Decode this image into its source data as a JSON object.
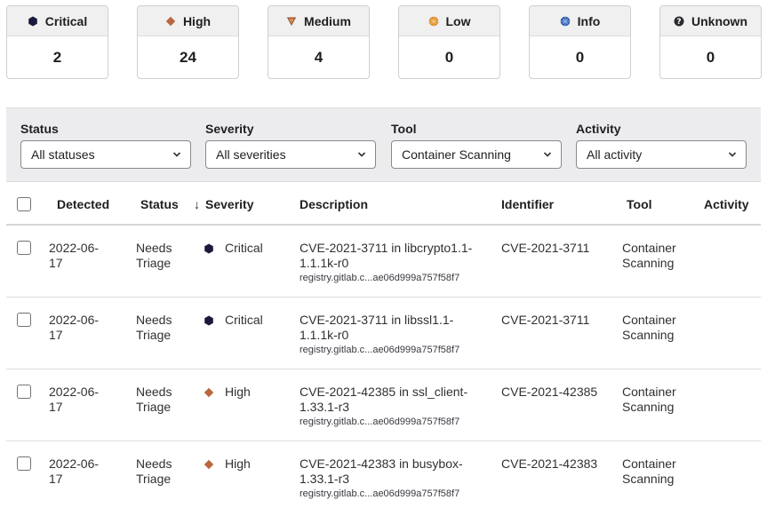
{
  "severity_cards": [
    {
      "label": "Critical",
      "count": "2",
      "icon": "critical-hexagon-icon",
      "color": "#2f2a6b"
    },
    {
      "label": "High",
      "count": "24",
      "icon": "high-diamond-icon",
      "color": "#c0724c"
    },
    {
      "label": "Medium",
      "count": "4",
      "icon": "medium-triangle-icon",
      "color": "#a4653e"
    },
    {
      "label": "Low",
      "count": "0",
      "icon": "low-circle-icon",
      "color": "#d68f2b"
    },
    {
      "label": "Info",
      "count": "0",
      "icon": "info-circle-icon",
      "color": "#2d5fb3"
    },
    {
      "label": "Unknown",
      "count": "0",
      "icon": "unknown-question-icon",
      "color": "#333238"
    }
  ],
  "filters": [
    {
      "label": "Status",
      "value": "All statuses"
    },
    {
      "label": "Severity",
      "value": "All severities"
    },
    {
      "label": "Tool",
      "value": "Container Scanning"
    },
    {
      "label": "Activity",
      "value": "All activity"
    }
  ],
  "table": {
    "columns": {
      "detected": "Detected",
      "status": "Status",
      "severity_arrow": "↓",
      "severity": "Severity",
      "description": "Description",
      "identifier": "Identifier",
      "tool": "Tool",
      "activity": "Activity"
    },
    "rows": [
      {
        "detected": "2022-06-17",
        "status": "Needs Triage",
        "severity": "Critical",
        "severity_icon": "critical-hexagon-icon",
        "desc_main": "CVE-2021-3711 in libcrypto1.1-1.1.1k-r0",
        "desc_sub": "registry.gitlab.c...ae06d999a757f58f7",
        "identifier": "CVE-2021-3711",
        "tool": "Container Scanning"
      },
      {
        "detected": "2022-06-17",
        "status": "Needs Triage",
        "severity": "Critical",
        "severity_icon": "critical-hexagon-icon",
        "desc_main": "CVE-2021-3711 in libssl1.1-1.1.1k-r0",
        "desc_sub": "registry.gitlab.c...ae06d999a757f58f7",
        "identifier": "CVE-2021-3711",
        "tool": "Container Scanning"
      },
      {
        "detected": "2022-06-17",
        "status": "Needs Triage",
        "severity": "High",
        "severity_icon": "high-diamond-icon",
        "desc_main": "CVE-2021-42385 in ssl_client-1.33.1-r3",
        "desc_sub": "registry.gitlab.c...ae06d999a757f58f7",
        "identifier": "CVE-2021-42385",
        "tool": "Container Scanning"
      },
      {
        "detected": "2022-06-17",
        "status": "Needs Triage",
        "severity": "High",
        "severity_icon": "high-diamond-icon",
        "desc_main": "CVE-2021-42383 in busybox-1.33.1-r3",
        "desc_sub": "registry.gitlab.c...ae06d999a757f58f7",
        "identifier": "CVE-2021-42383",
        "tool": "Container Scanning"
      }
    ]
  }
}
